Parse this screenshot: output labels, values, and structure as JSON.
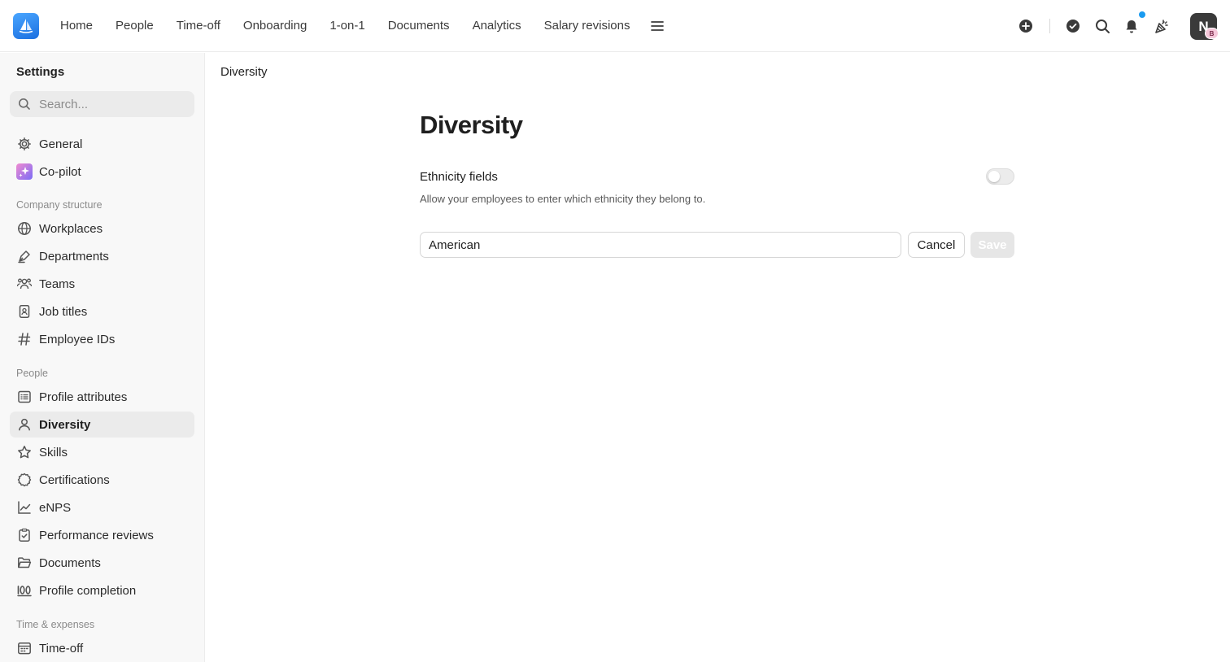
{
  "nav": {
    "logo": "sailboat-logo",
    "items": [
      "Home",
      "People",
      "Time-off",
      "Onboarding",
      "1-on-1",
      "Documents",
      "Analytics",
      "Salary revisions"
    ],
    "avatar_initial": "N",
    "avatar_badge": "B",
    "icons": [
      "plus-circle-icon",
      "check-circle-icon",
      "search-icon",
      "bell-icon",
      "party-icon"
    ]
  },
  "sidebar": {
    "title": "Settings",
    "search_placeholder": "Search...",
    "items": {
      "general": "General",
      "copilot": "Co-pilot",
      "section_company": "Company structure",
      "workplaces": "Workplaces",
      "departments": "Departments",
      "teams": "Teams",
      "job_titles": "Job titles",
      "employee_ids": "Employee IDs",
      "section_people": "People",
      "profile_attributes": "Profile attributes",
      "diversity": "Diversity",
      "skills": "Skills",
      "certifications": "Certifications",
      "enps": "eNPS",
      "performance_reviews": "Performance reviews",
      "documents": "Documents",
      "profile_completion": "Profile completion",
      "section_time": "Time & expenses",
      "time_off": "Time-off"
    }
  },
  "main": {
    "breadcrumb": "Diversity",
    "title": "Diversity",
    "field_title": "Ethnicity fields",
    "field_desc": "Allow your employees to enter which ethnicity they belong to.",
    "toggle_on": false,
    "input_value": "American",
    "cancel_label": "Cancel",
    "save_label": "Save"
  },
  "colors": {
    "accent_blue": "#1a9bf0",
    "sidebar_bg": "#f8f8f8",
    "active_item_bg": "#ebebeb",
    "save_disabled_bg": "#e6e6e6"
  }
}
